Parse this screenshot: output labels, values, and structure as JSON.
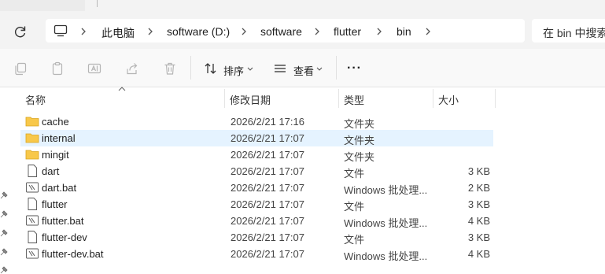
{
  "window": {
    "tab_hint": "+"
  },
  "address": {
    "breadcrumbs": [
      "此电脑",
      "software (D:)",
      "software",
      "flutter",
      "bin"
    ],
    "search_placeholder": "在 bin 中搜索"
  },
  "toolbar": {
    "sort_label": "排序",
    "view_label": "查看",
    "more_label": "···",
    "icons": [
      "copy-icon",
      "paste-icon",
      "rename-icon",
      "share-icon",
      "delete-icon",
      "sort-icon",
      "view-icon"
    ]
  },
  "columns": {
    "name": "名称",
    "date": "修改日期",
    "type": "类型",
    "size": "大小"
  },
  "files": [
    {
      "name": "cache",
      "date": "2026/2/21 17:16",
      "type": "文件夹",
      "size": "",
      "icon": "folder-icon",
      "selected": false
    },
    {
      "name": "internal",
      "date": "2026/2/21 17:07",
      "type": "文件夹",
      "size": "",
      "icon": "folder-icon",
      "selected": true
    },
    {
      "name": "mingit",
      "date": "2026/2/21 17:07",
      "type": "文件夹",
      "size": "",
      "icon": "folder-icon",
      "selected": false
    },
    {
      "name": "dart",
      "date": "2026/2/21 17:07",
      "type": "文件",
      "size": "3 KB",
      "icon": "file-icon",
      "selected": false
    },
    {
      "name": "dart.bat",
      "date": "2026/2/21 17:07",
      "type": "Windows 批处理...",
      "size": "2 KB",
      "icon": "batch-file-icon",
      "selected": false
    },
    {
      "name": "flutter",
      "date": "2026/2/21 17:07",
      "type": "文件",
      "size": "3 KB",
      "icon": "file-icon",
      "selected": false
    },
    {
      "name": "flutter.bat",
      "date": "2026/2/21 17:07",
      "type": "Windows 批处理...",
      "size": "4 KB",
      "icon": "batch-file-icon",
      "selected": false
    },
    {
      "name": "flutter-dev",
      "date": "2026/2/21 17:07",
      "type": "文件",
      "size": "3 KB",
      "icon": "file-icon",
      "selected": false
    },
    {
      "name": "flutter-dev.bat",
      "date": "2026/2/21 17:07",
      "type": "Windows 批处理...",
      "size": "4 KB",
      "icon": "batch-file-icon",
      "selected": false
    }
  ],
  "colors": {
    "selected_row": "#e5f3ff",
    "folder": "#f8c84a",
    "accent": "#0067c0"
  }
}
